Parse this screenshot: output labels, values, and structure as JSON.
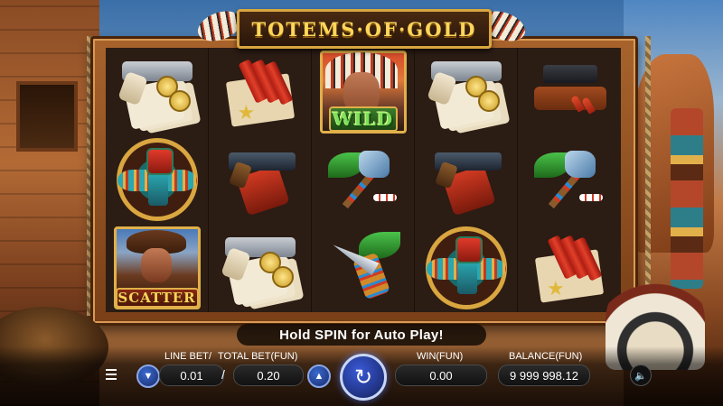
{
  "game": {
    "title": "TOTEMS·OF·GOLD",
    "hint": "Hold SPIN for Auto Play!"
  },
  "reels": {
    "rows": [
      [
        "pistol-cards",
        "dynamite",
        "wild",
        "pistol-cards",
        "holster"
      ],
      [
        "totem-bird",
        "revolver",
        "tomahawk",
        "revolver",
        "tomahawk"
      ],
      [
        "scatter",
        "pistol-cards",
        "knife",
        "totem-bird",
        "dynamite"
      ]
    ],
    "wild_label": "WILD",
    "scatter_label": "SCATTER"
  },
  "controls": {
    "line_bet_label": "LINE BET",
    "line_bet_value": "0.01",
    "separator": "/",
    "total_bet_label": "TOTAL BET(FUN)",
    "total_bet_value": "0.20",
    "win_label": "WIN(FUN)",
    "win_value": "0.00",
    "balance_label": "BALANCE(FUN)",
    "balance_value": "9 999 998.12",
    "decrease_icon": "chevron-down-icon",
    "increase_icon": "chevron-up-icon",
    "spin_icon": "refresh-icon",
    "menu_icon": "menu-icon",
    "sound_icon": "speaker-icon"
  }
}
